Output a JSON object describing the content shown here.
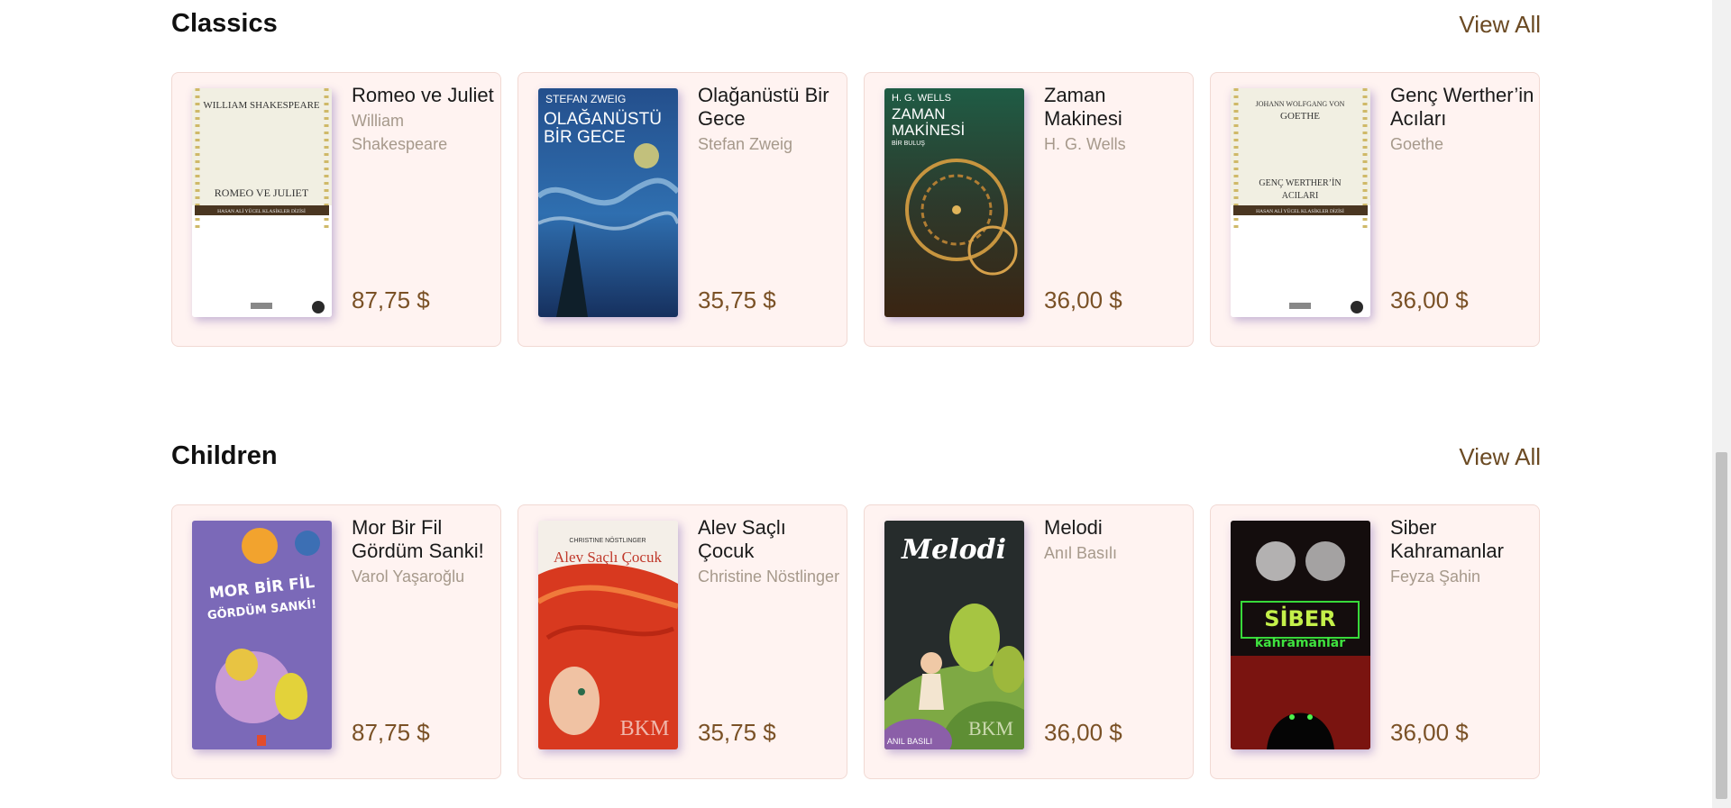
{
  "colors": {
    "card_bg": "#fff3f1",
    "price": "#7a5126",
    "author": "#a6998b",
    "link": "#6b4a23"
  },
  "sections": [
    {
      "title": "Classics",
      "view_all": "View All",
      "books": [
        {
          "title": "Romeo ve Juliet",
          "author": "William Shakespeare",
          "price": "87,75 $",
          "cover_text": {
            "top": "WILLIAM SHAKESPEARE",
            "title": "ROMEO VE JULIET",
            "series": "HASAN ALİ YÜCEL KLASİKLER DİZİSİ"
          }
        },
        {
          "title": "Olağanüstü Bir Gece",
          "author": "Stefan Zweig",
          "price": "35,75 $",
          "cover_text": {
            "top": "STEFAN ZWEIG",
            "title1": "OLAĞANÜSTÜ",
            "title2": "BİR GECE"
          }
        },
        {
          "title": "Zaman Makinesi",
          "author": "H. G. Wells",
          "price": "36,00 $",
          "cover_text": {
            "top": "H. G. WELLS",
            "title1": "ZAMAN",
            "title2": "MAKİNESİ",
            "sub": "BİR BULUŞ"
          }
        },
        {
          "title": "Genç Werther’in Acıları",
          "author": "Goethe",
          "price": "36,00 $",
          "cover_text": {
            "top1": "JOHANN WOLFGANG VON",
            "top2": "GOETHE",
            "title1": "GENÇ WERTHER’İN",
            "title2": "ACILARI",
            "series": "HASAN ALİ YÜCEL KLASİKLER DİZİSİ"
          }
        }
      ]
    },
    {
      "title": "Children",
      "view_all": "View All",
      "books": [
        {
          "title": "Mor Bir Fil Gördüm Sanki!",
          "author": "Varol Yaşaroğlu",
          "price": "87,75 $",
          "cover_text": {
            "title1": "MOR BİR FİL",
            "title2": "GÖRDÜM SANKİ!"
          }
        },
        {
          "title": "Alev Saçlı Çocuk",
          "author": "Christine Nöstlinger",
          "price": "35,75 $",
          "cover_text": {
            "top": "CHRISTINE NÖSTLINGER",
            "title": "Alev Saçlı Çocuk",
            "brand": "BKM"
          }
        },
        {
          "title": "Melodi",
          "author": "Anıl Basılı",
          "price": "36,00 $",
          "cover_text": {
            "title": "Melodi",
            "bottom": "ANIL BASILI",
            "brand": "BKM"
          }
        },
        {
          "title": "Siber Kahramanlar",
          "author": "Feyza Şahin",
          "price": "36,00 $",
          "cover_text": {
            "title1": "SİBER",
            "title2": "kahramanlar"
          }
        }
      ]
    }
  ]
}
